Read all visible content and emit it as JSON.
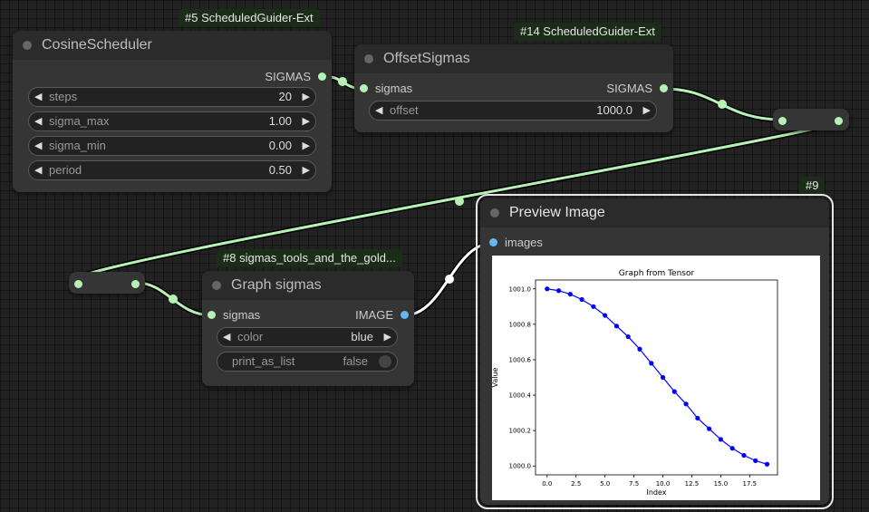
{
  "colors": {
    "link": "#b6f2b6",
    "image_link": "#ffffff",
    "canvas_bg": "#222222",
    "node_bg": "#353535",
    "title_bg": "#2b2b2b",
    "plot_line": "#0000ff"
  },
  "nodes": {
    "cosine": {
      "badge": "#5 ScheduledGuider-Ext",
      "title": "CosineScheduler",
      "output": "SIGMAS",
      "widgets": [
        {
          "label": "steps",
          "value": "20"
        },
        {
          "label": "sigma_max",
          "value": "1.00"
        },
        {
          "label": "sigma_min",
          "value": "0.00"
        },
        {
          "label": "period",
          "value": "0.50"
        }
      ]
    },
    "offset": {
      "badge": "#14 ScheduledGuider-Ext",
      "title": "OffsetSigmas",
      "input": "sigmas",
      "output": "SIGMAS",
      "widgets": [
        {
          "label": "offset",
          "value": "1000.0"
        }
      ]
    },
    "graph": {
      "badge": "#8 sigmas_tools_and_the_gold...",
      "title": "Graph sigmas",
      "input": "sigmas",
      "output": "IMAGE",
      "widgets": [
        {
          "label": "color",
          "value": "blue"
        }
      ],
      "toggle": {
        "label": "print_as_list",
        "value": "false"
      }
    },
    "preview": {
      "badge": "#9",
      "title": "Preview Image",
      "input": "images"
    }
  },
  "icons": {
    "arrow_left": "◀",
    "arrow_right": "▶"
  },
  "chart_data": {
    "type": "line",
    "title": "Graph from Tensor",
    "xlabel": "Index",
    "ylabel": "Value",
    "xticks": [
      "0.0",
      "2.5",
      "5.0",
      "7.5",
      "10.0",
      "12.5",
      "15.0",
      "17.5"
    ],
    "yticks": [
      "1000.0",
      "1000.2",
      "1000.4",
      "1000.6",
      "1000.8",
      "1001.0"
    ],
    "xlim": [
      -1,
      19.9
    ],
    "ylim": [
      999.95,
      1001.05
    ],
    "series": [
      {
        "color": "#0000ff",
        "marker": "circle",
        "x": [
          0,
          1,
          2,
          3,
          4,
          5,
          6,
          7,
          8,
          9,
          10,
          11,
          12,
          13,
          14,
          15,
          16,
          17,
          18,
          19
        ],
        "y": [
          1001.0,
          1000.99,
          1000.97,
          1000.94,
          1000.9,
          1000.85,
          1000.79,
          1000.73,
          1000.66,
          1000.58,
          1000.5,
          1000.42,
          1000.35,
          1000.27,
          1000.21,
          1000.15,
          1000.1,
          1000.06,
          1000.03,
          1000.01
        ]
      }
    ]
  }
}
